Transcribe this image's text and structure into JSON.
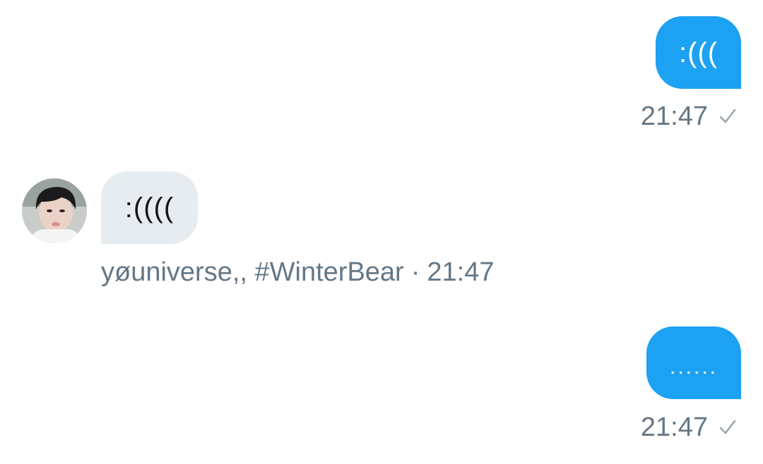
{
  "conversation": {
    "messages": [
      {
        "direction": "outgoing",
        "text": ":(((",
        "time": "21:47"
      },
      {
        "direction": "incoming",
        "text": ":((((",
        "sender": "yøuniverse,, #WinterBear",
        "separator": "·",
        "time": "21:47"
      },
      {
        "direction": "outgoing",
        "text": "......",
        "time": "21:47"
      }
    ]
  },
  "icons": {
    "sent_status": "checkmark-icon",
    "avatar": "user-avatar-photo"
  },
  "colors": {
    "outgoing_bubble": "#1da1f2",
    "incoming_bubble": "#e6ecf0",
    "meta_text": "#657786",
    "incoming_text": "#14171a"
  }
}
